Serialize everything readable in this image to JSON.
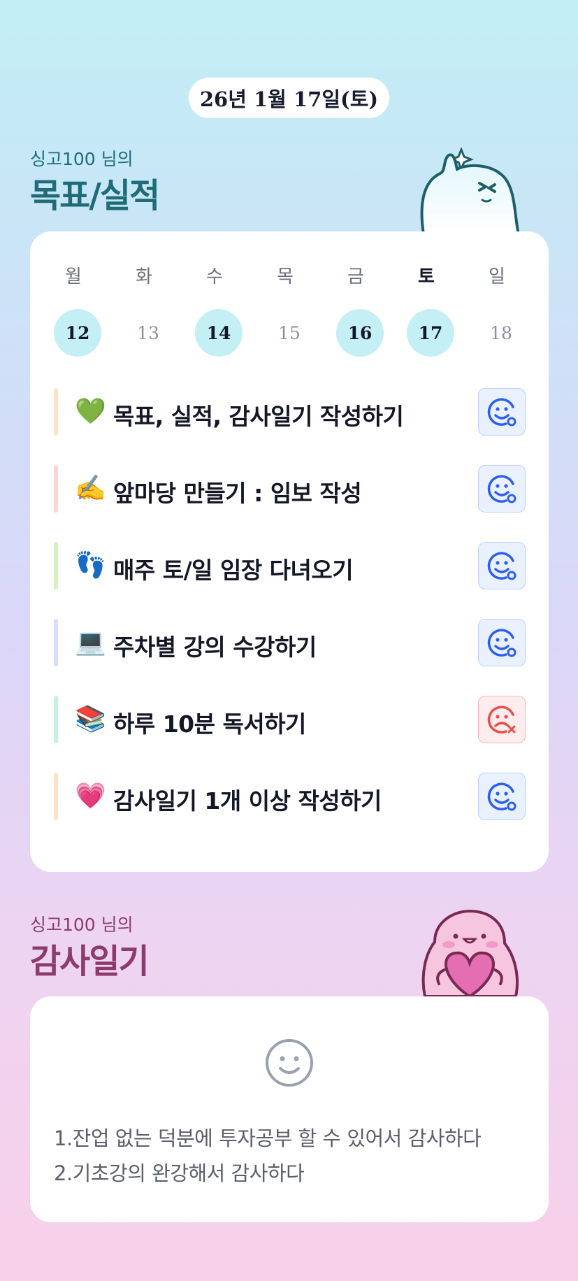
{
  "date_label": "26년 1월 17일(토)",
  "goals_section": {
    "subtitle": "싱고100 님의",
    "title": "목표/실적"
  },
  "week": {
    "days": [
      {
        "name": "월",
        "num": "12",
        "done": true,
        "today": false
      },
      {
        "name": "화",
        "num": "13",
        "done": false,
        "today": false
      },
      {
        "name": "수",
        "num": "14",
        "done": true,
        "today": false
      },
      {
        "name": "목",
        "num": "15",
        "done": false,
        "today": false
      },
      {
        "name": "금",
        "num": "16",
        "done": true,
        "today": false
      },
      {
        "name": "토",
        "num": "17",
        "done": true,
        "today": true
      },
      {
        "name": "일",
        "num": "18",
        "done": false,
        "today": false
      }
    ]
  },
  "tasks": [
    {
      "emoji": "💚",
      "label": "목표, 실적, 감사일기 작성하기",
      "bar_color": "#fbe3c4",
      "status": "done"
    },
    {
      "emoji": "✍️",
      "label": "앞마당 만들기 : 임보 작성",
      "bar_color": "#fbd6d3",
      "status": "done"
    },
    {
      "emoji": "👣",
      "label": "매주 토/일 임장 다녀오기",
      "bar_color": "#d4f2bd",
      "status": "done"
    },
    {
      "emoji": "💻",
      "label": "주차별 강의 수강하기",
      "bar_color": "#d6e0fb",
      "status": "done"
    },
    {
      "emoji": "📚",
      "label": "하루 10분 독서하기",
      "bar_color": "#c4f1e3",
      "status": "fail"
    },
    {
      "emoji": "💗",
      "label": "감사일기 1개 이상 작성하기",
      "bar_color": "#fde3c6",
      "status": "done"
    }
  ],
  "gratitude_section": {
    "subtitle": "싱고100 님의",
    "title": "감사일기"
  },
  "gratitude": {
    "icon": "smiley-face-icon",
    "lines": [
      "1.잔업 없는 덕분에 투자공부 할 수 있어서 감사하다",
      "2.기초강의 완강해서 감사하다"
    ]
  },
  "colors": {
    "ok_icon": "#2e5ef0",
    "fail_icon": "#e8504a",
    "teal_title": "#1f6c78",
    "plum_title": "#8c3c6c"
  }
}
